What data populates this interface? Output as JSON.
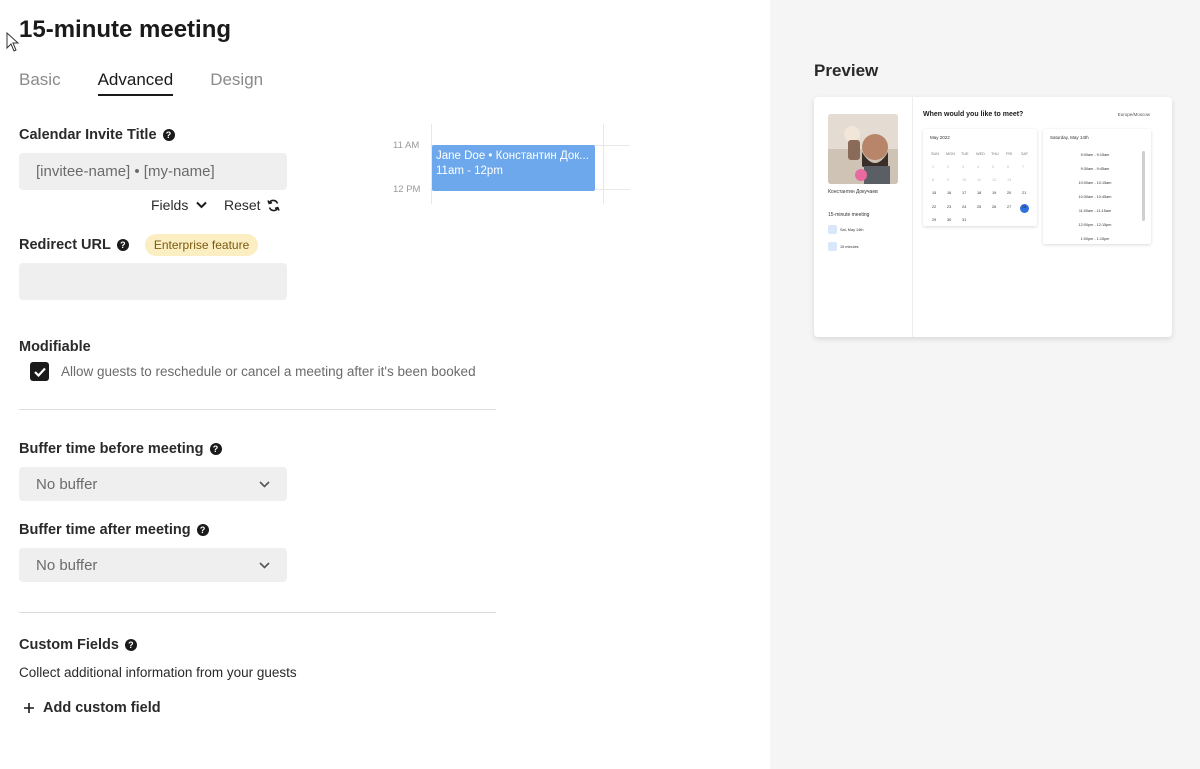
{
  "page": {
    "title": "15-minute meeting"
  },
  "tabs": [
    {
      "label": "Basic"
    },
    {
      "label": "Advanced"
    },
    {
      "label": "Design"
    }
  ],
  "invite_title": {
    "label": "Calendar Invite Title",
    "value": "[invitee-name] • [my-name]",
    "fields_label": "Fields",
    "reset_label": "Reset"
  },
  "calendar_example": {
    "time_11": "11 AM",
    "time_12": "12 PM",
    "event_title": "Jane Doe • Константин Док...",
    "event_time": "11am - 12pm"
  },
  "redirect": {
    "label": "Redirect URL",
    "badge": "Enterprise feature",
    "value": ""
  },
  "modifiable": {
    "label": "Modifiable",
    "checkbox_label": "Allow guests to reschedule or cancel a meeting after it's been booked",
    "checked": true
  },
  "buffer_before": {
    "label": "Buffer time before meeting",
    "value": "No buffer"
  },
  "buffer_after": {
    "label": "Buffer time after meeting",
    "value": "No buffer"
  },
  "custom_fields": {
    "label": "Custom Fields",
    "description": "Collect additional information from your guests",
    "add_label": "Add custom field"
  },
  "preview": {
    "title": "Preview",
    "question": "When would you like to meet?",
    "timezone": "Europe/Moscow",
    "host_name": "Константин Докучаев",
    "meeting_name": "15-minute meeting",
    "date_info": "Sat, May 14th",
    "duration_info": "15 minutes",
    "month": "May 2022",
    "weekdays": [
      "SUN",
      "MON",
      "TUE",
      "WED",
      "THU",
      "FRI",
      "SAT"
    ],
    "selected_day_label": "Saturday, May 14th",
    "slots": [
      "9:00am - 9:15am",
      "9:30am - 9:45am",
      "10:00am - 10:15am",
      "10:30am - 10:45am",
      "11:00am - 11:15am",
      "12:00pm - 12:15pm",
      "1:00pm - 1:15pm"
    ]
  },
  "colors": {
    "accent": "#2f6fe0",
    "event": "#6ea8ec",
    "badge_bg": "#fbeec2"
  }
}
